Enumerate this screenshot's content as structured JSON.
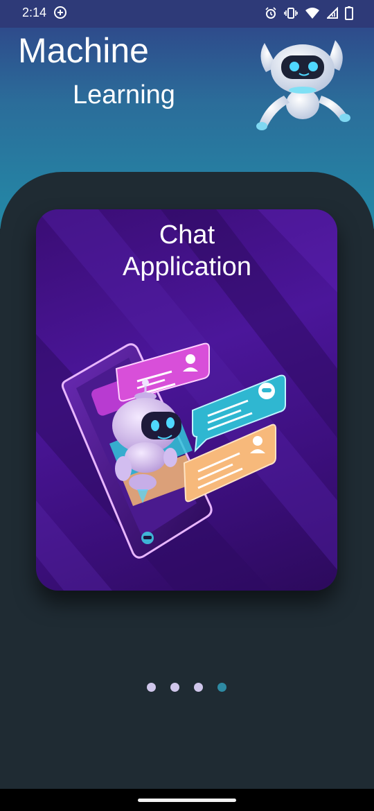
{
  "status_bar": {
    "time": "2:14",
    "icons": [
      "add-circle-icon",
      "alarm-icon",
      "vibrate-icon",
      "wifi-icon",
      "signal-icon",
      "battery-icon"
    ]
  },
  "header": {
    "title_line1": "Machine",
    "title_line2": "Learning",
    "logo_icon": "robot-mascot-icon"
  },
  "card": {
    "title_line1": "Chat",
    "title_line2": "Application",
    "illustration": "robot-chat-phone-illustration"
  },
  "pager": {
    "page_count": 4,
    "active_index": 3
  },
  "colors": {
    "header_top": "#2f3f86",
    "header_bottom": "#238aa7",
    "panel": "#1f2b33",
    "card": "#4b169a",
    "dot_inactive": "#cfc6ea",
    "dot_active": "#2e8aa3"
  }
}
